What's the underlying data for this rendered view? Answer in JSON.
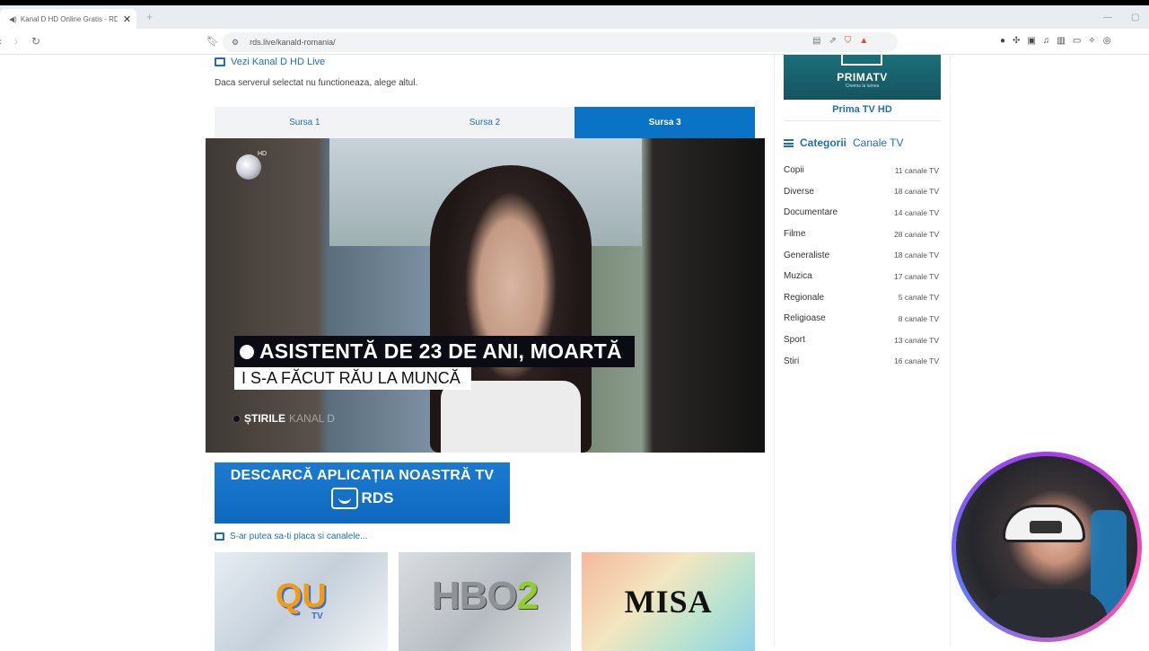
{
  "browser": {
    "tab_title": "Kanal D HD Online Gratis - RD",
    "tab_close": "✕",
    "new_tab": "+",
    "url": "rds.live/kanald-romania/"
  },
  "main": {
    "watch_live": "Vezi Kanal D HD Live",
    "server_hint": "Daca serverul selectat nu functioneaza, alege altul.",
    "sources": [
      "Sursa 1",
      "Sursa 2",
      "Sursa 3"
    ],
    "active_source": "Sursa 3",
    "video": {
      "channel_hd": "HD",
      "headline": "ASISTENTĂ DE 23 DE ANI, MOARTĂ",
      "subline": "I S-A FĂCUT RĂU LA MUNCĂ",
      "program": "ȘTIRILE",
      "program_channel": "KANAL D"
    },
    "app_banner": {
      "line1": "DESCARCĂ APLICAȚIA NOASTRĂ TV",
      "brand": "RDS"
    },
    "suggest": "S-ar putea sa-ti placa si canalele...",
    "thumbs": [
      {
        "logo_text": "QU",
        "sub": "TV"
      },
      {
        "logo_text": "HBO",
        "sub": "2"
      },
      {
        "logo_text": "MISA"
      }
    ]
  },
  "sidebar": {
    "prima_logo": "PRIMATV",
    "prima_slogan": "Cinema la lumea",
    "prima_title": "Prima TV HD",
    "categories_prefix": "Categorii",
    "categories_suffix": "Canale TV",
    "categories": [
      {
        "name": "Copii",
        "count": "11 canale TV"
      },
      {
        "name": "Diverse",
        "count": "18 canale TV"
      },
      {
        "name": "Documentare",
        "count": "14 canale TV"
      },
      {
        "name": "Filme",
        "count": "28 canale TV"
      },
      {
        "name": "Generaliste",
        "count": "18 canale TV"
      },
      {
        "name": "Muzica",
        "count": "17 canale TV"
      },
      {
        "name": "Regionale",
        "count": "5 canale TV"
      },
      {
        "name": "Religioase",
        "count": "8 canale TV"
      },
      {
        "name": "Sport",
        "count": "13 canale TV"
      },
      {
        "name": "Stiri",
        "count": "16 canale TV"
      }
    ]
  },
  "colors": {
    "accent": "#0a73c6",
    "link": "#1f6fb5"
  }
}
